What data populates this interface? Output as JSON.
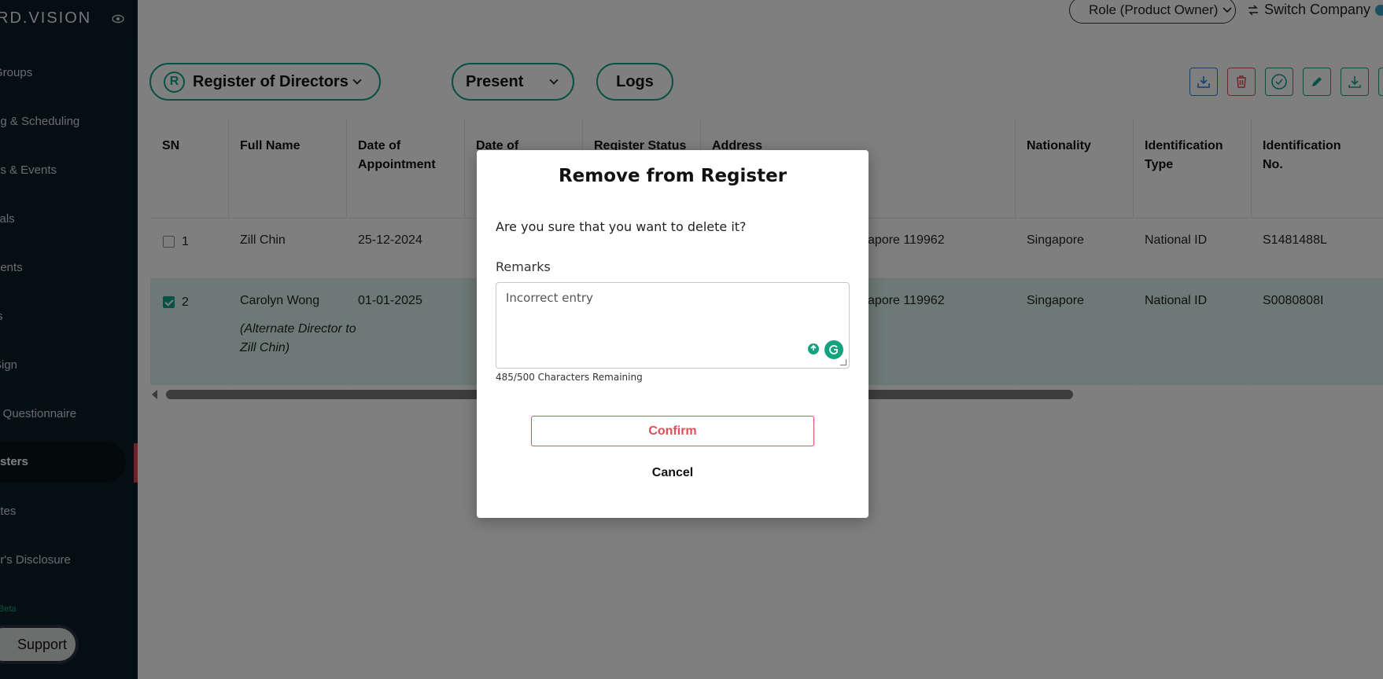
{
  "sidebar": {
    "logo": "RD.VISION",
    "items": [
      {
        "label": "Groups"
      },
      {
        "label": "ng & Scheduling"
      },
      {
        "label": "gs & Events"
      },
      {
        "label": "vals"
      },
      {
        "label": "nents"
      },
      {
        "label": "ts"
      },
      {
        "label": "Sign"
      },
      {
        "label": "y Questionnaire"
      },
      {
        "label": "sters"
      },
      {
        "label": "ates"
      },
      {
        "label": "or's Disclosure"
      }
    ],
    "beta": "Beta",
    "support": "Support",
    "accent": "#e0424a"
  },
  "topbar": {
    "role": "Role (Product Owner)",
    "switch_company": "Switch Company"
  },
  "filters": {
    "register": "Register of Directors",
    "register_badge": "R",
    "status": "Present",
    "logs": "Logs"
  },
  "table": {
    "headers": {
      "sn": "SN",
      "full_name": "Full Name",
      "date_appointment": "Date of Appointment",
      "date_of": "Date of",
      "register_status": "Register Status",
      "address": "Address",
      "nationality": "Nationality",
      "id_type": "Identification Type",
      "id_no": "Identification No."
    },
    "rows": [
      {
        "sn": "1",
        "checked": false,
        "name": "Zill Chin",
        "note": "",
        "date_appointment": "25-12-2024",
        "address": "Singapore 119962",
        "nationality": "Singapore",
        "id_type": "National ID",
        "id_no": "S1481488L"
      },
      {
        "sn": "2",
        "checked": true,
        "name": "Carolyn Wong",
        "note": "(Alternate Director to Zill Chin)",
        "date_appointment": "01-01-2025",
        "address": "Singapore 119962",
        "nationality": "Singapore",
        "id_type": "National ID",
        "id_no": "S0080808I"
      }
    ]
  },
  "modal": {
    "title": "Remove from Register",
    "message": "Are you sure that you want to delete it?",
    "remarks_label": "Remarks",
    "remarks_value": "Incorrect entry",
    "char_count": "485/500 Characters Remaining",
    "confirm": "Confirm",
    "cancel": "Cancel"
  },
  "colors": {
    "teal": "#12a38a",
    "danger": "#e04f56",
    "sidebar_bg": "#0a1f27"
  }
}
